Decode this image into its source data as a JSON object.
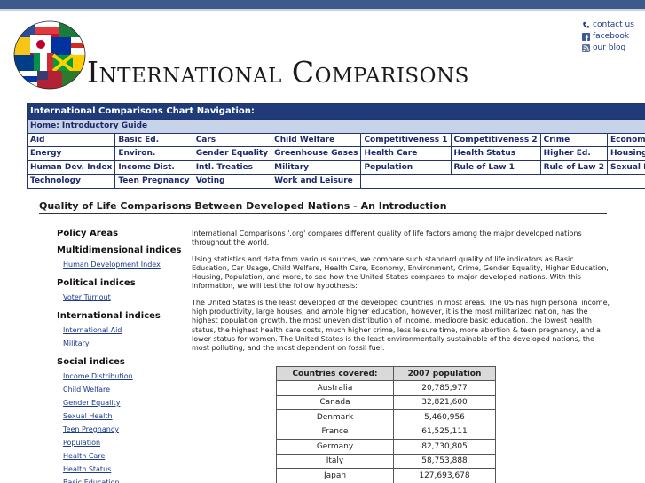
{
  "header": {
    "logo_text": "International Comparisons",
    "links": [
      {
        "label": "contact us",
        "icon": "phone-icon"
      },
      {
        "label": "facebook",
        "icon": "facebook-icon"
      },
      {
        "label": "our blog",
        "icon": "rss-icon"
      }
    ]
  },
  "nav": {
    "title": "International Comparisons Chart Navigation:",
    "home": "Home: Introductory Guide",
    "rows": [
      [
        "Aid",
        "Basic Ed.",
        "Cars",
        "Child Welfare",
        "Competitiveness 1",
        "Competitiveness 2",
        "Crime",
        "Economy"
      ],
      [
        "Energy",
        "Environ.",
        "Gender Equality",
        "Greenhouse Gases",
        "Health Care",
        "Health Status",
        "Higher Ed.",
        "Housing"
      ],
      [
        "Human Dev. Index",
        "Income Dist.",
        "Intl. Treaties",
        "Military",
        "Population",
        "Rule of Law 1",
        "Rule of Law 2",
        "Sexual Health"
      ],
      [
        "Technology",
        "Teen Pregnancy",
        "Voting",
        "Work and Leisure"
      ]
    ]
  },
  "main": {
    "title": "Quality of Life Comparisons Between Developed Nations - An Introduction",
    "paragraphs": [
      "International Comparisons '.org' compares different quality of life factors among the major developed nations throughout the world.",
      "Using statistics and data from various sources, we compare such standard quality of life indicators as Basic Education, Car Usage, Child Welfare, Health Care, Economy, Environment, Crime, Gender Equality, Higher Education, Housing, Population, and more, to see how the United States compares to major developed nations. With this information, we will test the follow hypothesis:",
      "The United States is the least developed of the developed countries in most areas. The US has high personal income, high productivity, large houses, and ample higher education, however, it is the most militarized nation, has the highest population growth, the most uneven distribution of income, mediocre basic education, the lowest health status, the highest health care costs, much higher crime, less leisure time, more abortion & teen pregnancy, and a lower status for women. The United States is the least environmentally sustainable of the developed nations, the most polluting, and the most dependent on fossil fuel."
    ]
  },
  "sidebar": {
    "title": "Policy Areas",
    "groups": [
      {
        "heading": "Multidimensional indices",
        "links": [
          "Human Development Index"
        ]
      },
      {
        "heading": "Political indices",
        "links": [
          "Voter Turnout"
        ]
      },
      {
        "heading": "International indices",
        "links": [
          "International Aid",
          "Military"
        ]
      },
      {
        "heading": "Social indices",
        "links": [
          "Income Distribution",
          "Child Welfare",
          "Gender Equality",
          "Sexual Health",
          "Teen Pregnancy",
          "Population",
          "Health Care",
          "Health Status",
          "Basic Education"
        ]
      }
    ]
  },
  "population_table": {
    "headers": [
      "Countries covered:",
      "2007 population"
    ],
    "rows": [
      [
        "Australia",
        "20,785,977"
      ],
      [
        "Canada",
        "32,821,600"
      ],
      [
        "Denmark",
        "5,460,956"
      ],
      [
        "France",
        "61,525,111"
      ],
      [
        "Germany",
        "82,730,805"
      ],
      [
        "Italy",
        "58,753,888"
      ],
      [
        "Japan",
        "127,693,678"
      ]
    ]
  },
  "colors": {
    "nav_header_bg": "#1f3b7a",
    "nav_home_bg": "#c7d3e8",
    "link": "#1b3a8a",
    "top_bar": "#3d5a8a"
  }
}
